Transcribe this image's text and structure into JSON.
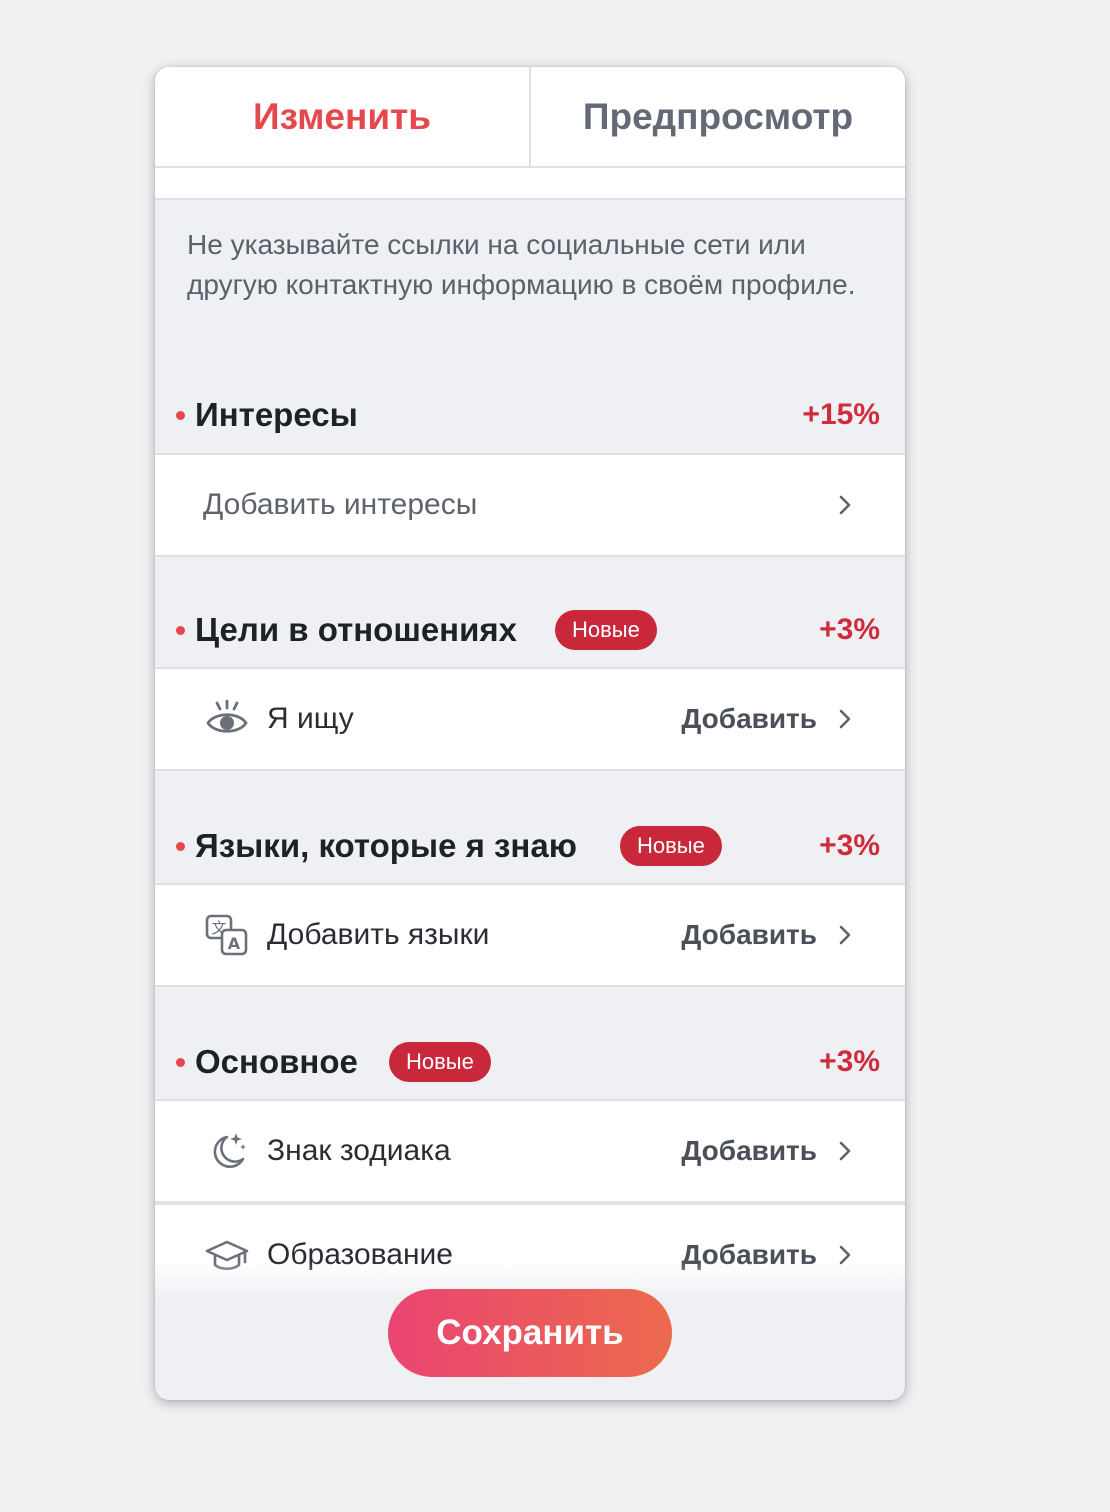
{
  "tabs": [
    {
      "label": "Изменить",
      "active": true
    },
    {
      "label": "Предпросмотр",
      "active": false
    }
  ],
  "notice": "Не указывайте ссылки на социальные сети или другую контактную информацию в своём профиле.",
  "sections": {
    "interests": {
      "title": "Интересы",
      "percent": "+15%",
      "row": {
        "label": "Добавить интересы"
      }
    },
    "goals": {
      "title": "Цели в отношениях",
      "badge": "Новые",
      "percent": "+3%",
      "row": {
        "label": "Я ищу",
        "action": "Добавить",
        "icon": "eye-icon"
      }
    },
    "languages": {
      "title": "Языки, которые я знаю",
      "badge": "Новые",
      "percent": "+3%",
      "row": {
        "label": "Добавить языки",
        "action": "Добавить",
        "icon": "translate-icon"
      }
    },
    "basics": {
      "title": "Основное",
      "badge": "Новые",
      "percent": "+3%",
      "rows": [
        {
          "label": "Знак зодиака",
          "action": "Добавить",
          "icon": "moon-stars-icon"
        },
        {
          "label": "Образование",
          "action": "Добавить",
          "icon": "graduation-cap-icon"
        }
      ]
    }
  },
  "save_button": "Сохранить",
  "colors": {
    "accent": "#e5484d",
    "badge": "#c8283a",
    "percent": "#cf2c3c",
    "save_gradient_start": "#ea4472",
    "save_gradient_end": "#ec6a4c"
  }
}
